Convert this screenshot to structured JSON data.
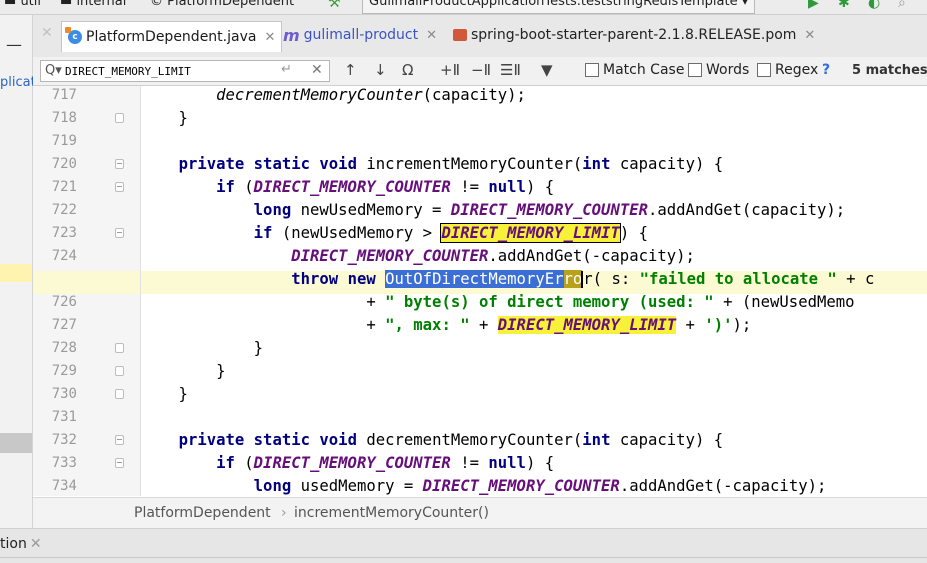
{
  "navbar": {
    "crumbs": [
      "util",
      "internal",
      "PlatformDependent"
    ],
    "run_config": "GulimallProductApplicationTests.teststringRedisTemplate"
  },
  "left_strip": {
    "clipped_label": "plicati"
  },
  "tabs": [
    {
      "label": "PlatformDependent.java",
      "icon": "java-class-icon",
      "active": true
    },
    {
      "label": "gulimall-product",
      "icon": "maven-module-icon",
      "active": false
    },
    {
      "label": "spring-boot-starter-parent-2.1.8.RELEASE.pom",
      "icon": "pom-file-icon",
      "active": false
    }
  ],
  "search": {
    "query": "DIRECT_MEMORY_LIMIT",
    "match_case_label": "Match Case",
    "words_label": "Words",
    "regex_label": "Regex",
    "help": "?",
    "match_count": "5 matches"
  },
  "code": {
    "lines": [
      {
        "num": "717",
        "text": "        decrementMemoryCounter(capacity);"
      },
      {
        "num": "718",
        "text": "    }"
      },
      {
        "num": "719",
        "text": ""
      },
      {
        "num": "720",
        "text": "    private static void incrementMemoryCounter(int capacity) {"
      },
      {
        "num": "721",
        "text": "        if (DIRECT_MEMORY_COUNTER != null) {"
      },
      {
        "num": "722",
        "text": "            long newUsedMemory = DIRECT_MEMORY_COUNTER.addAndGet(capacity);"
      },
      {
        "num": "723",
        "text": "            if (newUsedMemory > DIRECT_MEMORY_LIMIT) {"
      },
      {
        "num": "724",
        "text": "                DIRECT_MEMORY_COUNTER.addAndGet(-capacity);"
      },
      {
        "num": "725",
        "text": "                throw new OutOfDirectMemoryError( s: \"failed to allocate \" + c"
      },
      {
        "num": "726",
        "text": "                        + \" byte(s) of direct memory (used: \" + (newUsedMemo"
      },
      {
        "num": "727",
        "text": "                        + \", max: \" + DIRECT_MEMORY_LIMIT + ')');"
      },
      {
        "num": "728",
        "text": "            }"
      },
      {
        "num": "729",
        "text": "        }"
      },
      {
        "num": "730",
        "text": "    }"
      },
      {
        "num": "731",
        "text": ""
      },
      {
        "num": "732",
        "text": "    private static void decrementMemoryCounter(int capacity) {"
      },
      {
        "num": "733",
        "text": "        if (DIRECT_MEMORY_COUNTER != null) {"
      },
      {
        "num": "734",
        "text": "            long usedMemory = DIRECT_MEMORY_COUNTER.addAndGet(-capacity);"
      }
    ],
    "current_line": "725",
    "highlighted_term": "DIRECT_MEMORY_LIMIT",
    "selected_text": "OutOfDirectMemoryError",
    "param_hint": "s:"
  },
  "breadcrumb": {
    "items": [
      "PlatformDependent",
      "incrementMemoryCounter()"
    ]
  },
  "bottom": {
    "tool_window_label": "tion"
  },
  "colors": {
    "keyword": "#000080",
    "constant": "#660e7a",
    "string": "#008000",
    "search_highlight": "#f7f13a",
    "selection": "#3c6fd5",
    "current_line": "#fcfad2"
  }
}
